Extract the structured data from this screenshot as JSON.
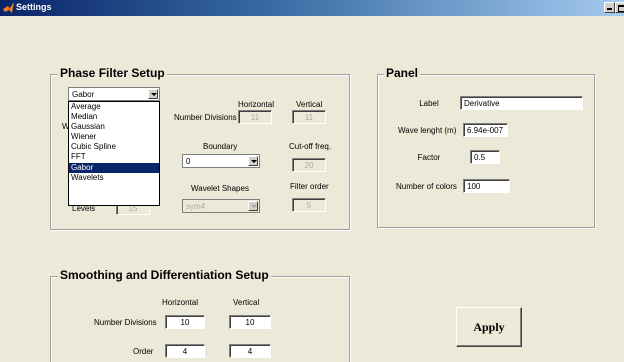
{
  "window": {
    "title": "Settings"
  },
  "phase_filter": {
    "title": "Phase Filter Setup",
    "filter_select": "Gabor",
    "dropdown_options": [
      "Average",
      "Median",
      "Gaussian",
      "Wiener",
      "Cubic Spline",
      "FFT",
      "Gabor",
      "Wavelets"
    ],
    "selected_option": "Gabor",
    "hidden_label_fragment": "W",
    "levels_label": "Levels",
    "levels_value": "15",
    "horizontal_label": "Horizontal",
    "vertical_label": "Vertical",
    "number_divisions_label": "Number Divisions",
    "horizontal_value": "11",
    "vertical_value": "11",
    "boundary_label": "Boundary",
    "boundary_value": "0",
    "cutoff_label": "Cut-off freq.",
    "cutoff_value": "20",
    "wavelet_shapes_label": "Wavelet Shapes",
    "wavelet_shape_value": "sym4",
    "filter_order_label": "Filter order",
    "filter_order_value": "5"
  },
  "panel": {
    "title": "Panel",
    "label_label": "Label",
    "label_value": "Derivative",
    "wavelength_label": "Wave lenght (m)",
    "wavelength_value": "6.94e-007",
    "factor_label": "Factor",
    "factor_value": "0.5",
    "colors_label": "Number of colors",
    "colors_value": "100"
  },
  "smoothing": {
    "title": "Smoothing and Differentiation Setup",
    "horizontal_label": "Horizontal",
    "vertical_label": "Vertical",
    "number_divisions_label": "Number Divisions",
    "horizontal_divisions": "10",
    "vertical_divisions": "10",
    "order_label": "Order",
    "horizontal_order": "4",
    "vertical_order": "4"
  },
  "apply_label": "Apply"
}
